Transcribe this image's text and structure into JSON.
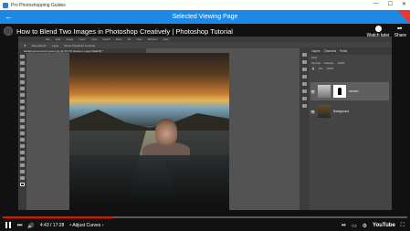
{
  "window": {
    "title": "Pro Photoshopping Guides",
    "controls": [
      "—",
      "☐",
      "✕"
    ]
  },
  "navbar": {
    "back": "←",
    "title": "Selected Viewing Page"
  },
  "youtube": {
    "video_title": "How to Blend Two Images in Photoshop Creatively | Photoshop Tutorial",
    "watch_later": "Watch later",
    "share": "Share",
    "time_current": "4:43",
    "time_total": "17:28",
    "chapter": "Adjust Curves",
    "progress": 0.27,
    "logo": "YouTube"
  },
  "photoshop": {
    "menu": [
      "File",
      "Edit",
      "Image",
      "Layer",
      "Type",
      "Select",
      "Filter",
      "3D",
      "View",
      "Window",
      "Help"
    ],
    "options": [
      "Auto-Select:",
      "Layer",
      "Show Transform Controls"
    ],
    "doc_tab": "background-women-green.jpg @ 66.7% (women, Layer Mask/8) *",
    "panel_tabs": [
      "Layers",
      "Channels",
      "Paths"
    ],
    "kind_label": "Kind",
    "blend_mode": "Normal",
    "opacity_label": "Opacity:",
    "opacity_value": "100%",
    "fill_label": "Fill:",
    "fill_value": "100%",
    "layers": [
      {
        "name": "women"
      },
      {
        "name": "Background"
      }
    ]
  }
}
